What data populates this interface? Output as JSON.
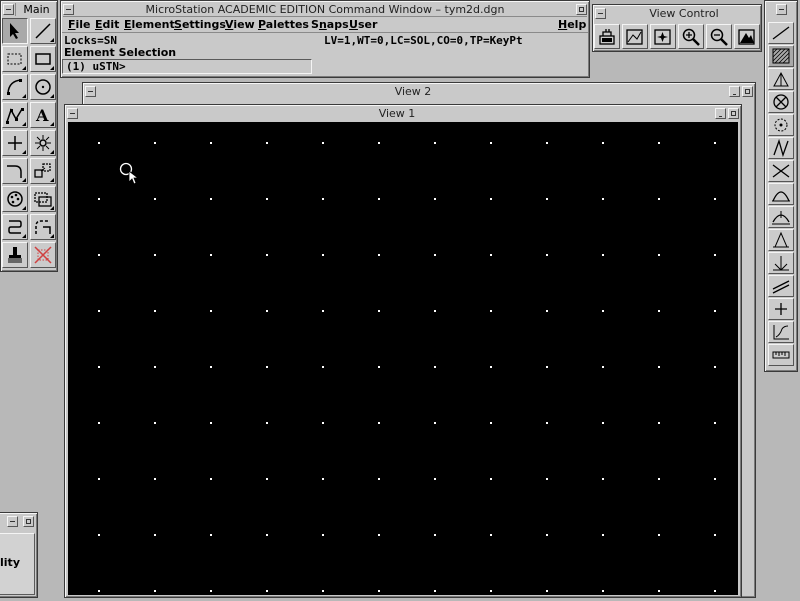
{
  "main_palette": {
    "title": "Main"
  },
  "command_window": {
    "title": "MicroStation ACADEMIC EDITION Command Window – tym2d.dgn",
    "menus": [
      "File",
      "Edit",
      "Element",
      "Settings",
      "View",
      "Palettes",
      "Snaps",
      "User"
    ],
    "menu_underline": [
      "F",
      "E",
      "E",
      "S",
      "V",
      "P",
      "n",
      "U"
    ],
    "help": "Help",
    "locks": "Locks=SN",
    "status": "LV=1,WT=0,LC=SOL,CO=0,TP=KeyPt",
    "prompt_label": "Element Selection",
    "input_text": "(1) uSTN>"
  },
  "view_control": {
    "title": "View Control",
    "tools": [
      "update-view-icon",
      "window-area-icon",
      "fit-view-icon",
      "zoom-in-icon",
      "zoom-out-icon",
      "fit-all-icon"
    ]
  },
  "view2": {
    "title": "View 2"
  },
  "view1": {
    "title": "View 1",
    "background": "#000000",
    "grid_color": "#ffffff"
  },
  "lower_left_panel": {
    "text": "ality"
  },
  "colors": {
    "chrome": "#c9c9c9",
    "desktop": "#b8b8b8"
  }
}
